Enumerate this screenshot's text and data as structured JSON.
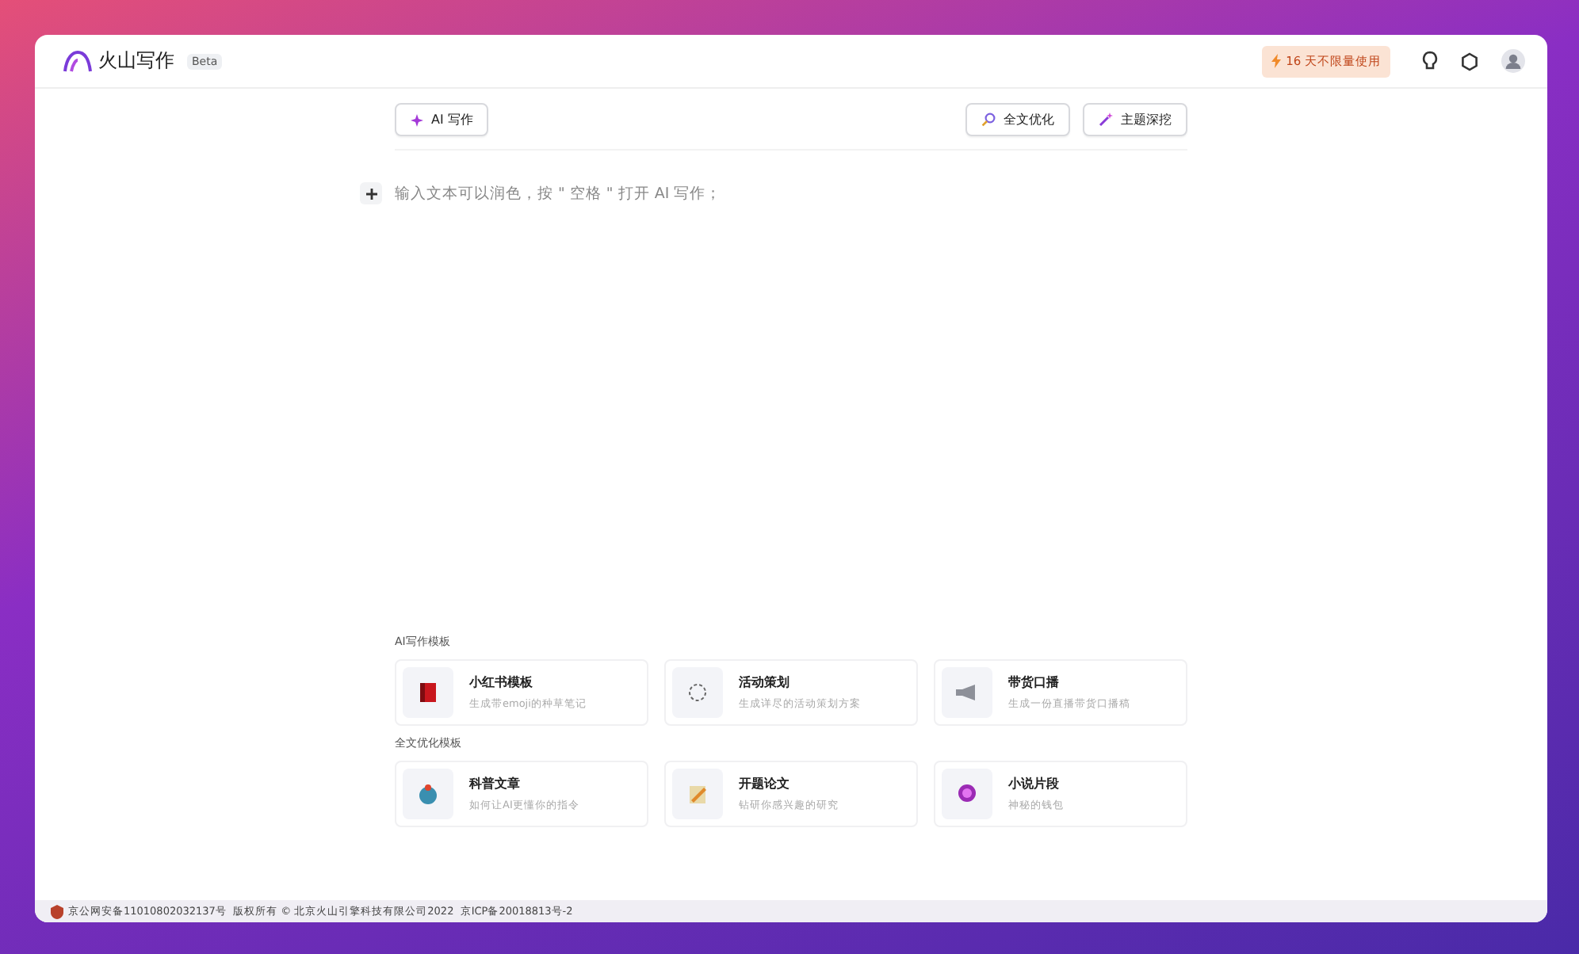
{
  "app": {
    "name": "火山写作",
    "badge": "Beta"
  },
  "trial": {
    "text": "16 天不限量使用"
  },
  "toolbar": {
    "left": [
      {
        "label": "AI 写作",
        "kind": "write"
      }
    ],
    "right": [
      {
        "label": "全文优化",
        "kind": "polish"
      },
      {
        "label": "主题深挖",
        "kind": "wand"
      }
    ]
  },
  "editor": {
    "placeholder": "输入文本可以润色，按 \" 空格 \" 打开 AI 写作；"
  },
  "sections": [
    {
      "title": "AI写作模板",
      "items": [
        {
          "title": "小红书模板",
          "desc": "生成带emoji的种草笔记",
          "kind": "book"
        },
        {
          "title": "活动策划",
          "desc": "生成详尽的活动策划方案",
          "kind": "ring"
        },
        {
          "title": "带货口播",
          "desc": "生成一份直播带货口播稿",
          "kind": "megaphone"
        }
      ]
    },
    {
      "title": "全文优化模板",
      "items": [
        {
          "title": "科普文章",
          "desc": "如何让AI更懂你的指令",
          "kind": "globe"
        },
        {
          "title": "开题论文",
          "desc": "钻研你感兴趣的研究",
          "kind": "pencil"
        },
        {
          "title": "小说片段",
          "desc": "神秘的钱包",
          "kind": "orb"
        }
      ]
    }
  ],
  "footer": {
    "text": "京公网安备11010802032137号  版权所有 © 北京火山引擎科技有限公司2022  京ICP备20018813号-2"
  }
}
